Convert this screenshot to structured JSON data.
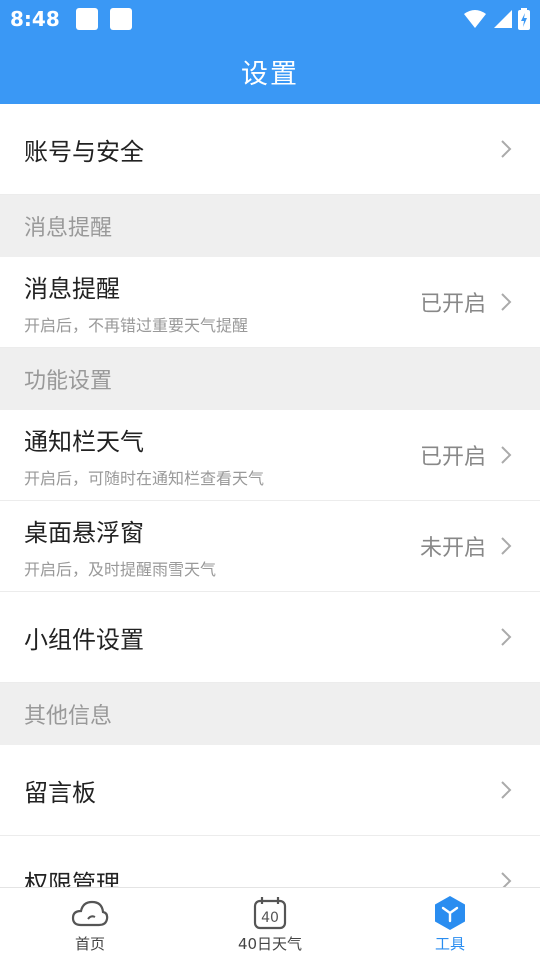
{
  "status_bar": {
    "time": "8:48",
    "icons": [
      "notification-square",
      "notification-square",
      "wifi-icon",
      "signal-icon",
      "battery-icon"
    ]
  },
  "header": {
    "title": "设置"
  },
  "list": {
    "account": {
      "title": "账号与安全"
    },
    "section_message": {
      "label": "消息提醒"
    },
    "message": {
      "title": "消息提醒",
      "subtitle": "开启后，不再错过重要天气提醒",
      "status": "已开启"
    },
    "section_function": {
      "label": "功能设置"
    },
    "notification_weather": {
      "title": "通知栏天气",
      "subtitle": "开启后，可随时在通知栏查看天气",
      "status": "已开启"
    },
    "floating_window": {
      "title": "桌面悬浮窗",
      "subtitle": "开启后，及时提醒雨雪天气",
      "status": "未开启"
    },
    "widget": {
      "title": "小组件设置"
    },
    "section_other": {
      "label": "其他信息"
    },
    "message_board": {
      "title": "留言板"
    },
    "permission": {
      "title": "权限管理"
    }
  },
  "bottom_nav": {
    "items": [
      {
        "label": "首页",
        "icon": "cloud-icon",
        "active": false
      },
      {
        "label": "40日天气",
        "icon": "calendar-40-icon",
        "active": false,
        "badge": "40"
      },
      {
        "label": "工具",
        "icon": "tools-cube-icon",
        "active": true
      }
    ]
  },
  "colors": {
    "primary": "#3a98f5",
    "active_tab": "#2a8df0",
    "background": "#efefef"
  }
}
